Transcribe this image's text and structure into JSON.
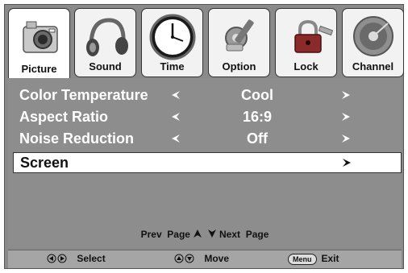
{
  "tabs": [
    {
      "label": "Picture",
      "icon": "camera-icon",
      "active": true
    },
    {
      "label": "Sound",
      "icon": "headphones-icon",
      "active": false
    },
    {
      "label": "Time",
      "icon": "clock-icon",
      "active": false
    },
    {
      "label": "Option",
      "icon": "tools-icon",
      "active": false
    },
    {
      "label": "Lock",
      "icon": "padlock-icon",
      "active": false
    },
    {
      "label": "Channel",
      "icon": "satellite-dish-icon",
      "active": false
    }
  ],
  "settings": [
    {
      "name": "Color Temperature",
      "value": "Cool"
    },
    {
      "name": "Aspect Ratio",
      "value": "16:9"
    },
    {
      "name": "Noise Reduction",
      "value": "Off"
    }
  ],
  "screen_item": {
    "name": "Screen"
  },
  "paging": {
    "prev": "Prev  Page",
    "next": "Next  Page"
  },
  "footer": {
    "select": "Select",
    "move": "Move",
    "menu_key": "Menu",
    "exit": "Exit"
  },
  "colors": {
    "panel": "#8d8d8d",
    "frame": "#8a8a8a",
    "footer": "#a5a5a5",
    "text": "#ffffff"
  }
}
